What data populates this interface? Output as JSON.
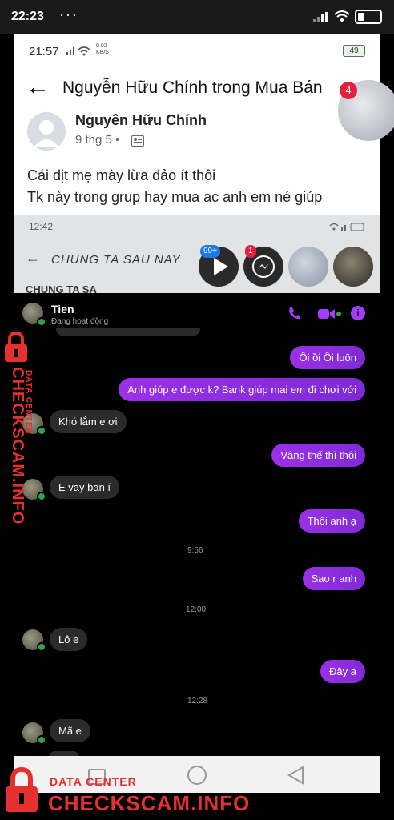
{
  "outer_status": {
    "time": "22:23",
    "dots": "···"
  },
  "inner_status": {
    "time": "21:57",
    "speed": "0.02 KB/S",
    "battery": "49"
  },
  "fb_header": {
    "title": "Nguyễn Hữu Chính trong Mua Bán"
  },
  "chat_head_badge": "4",
  "post": {
    "author": "Nguyên Hữu Chính",
    "date": "9 thg 5 •",
    "line1": "Cái địt mẹ mày lừa đảo ít thôi",
    "line2": "Tk này trong grup hay mua ac anh em né giúp"
  },
  "nested": {
    "status_time": "12:42",
    "title": "CHUNG TA SAU NAY",
    "subtitle": "CHUNG TA SA",
    "badge_a": "99+",
    "badge_b": "1"
  },
  "messenger": {
    "contact_name": "Tien",
    "contact_status": "Đang hoạt động",
    "accent": "#8a2be2",
    "messages": [
      {
        "side": "out",
        "text": "Ối ồi Ồi luôn"
      },
      {
        "side": "out",
        "text": "Anh giúp e được k? Bank giúp mai em đi chơi với"
      },
      {
        "side": "in",
        "text": "Khó lắm e ơi"
      },
      {
        "side": "out",
        "text": "Vâng thế thì thôi"
      },
      {
        "side": "in",
        "text": "E vay bạn í"
      },
      {
        "side": "out",
        "text": "Thôi anh ạ"
      },
      {
        "side": "time",
        "text": "9:56"
      },
      {
        "side": "out",
        "text": "Sao r anh"
      },
      {
        "side": "time",
        "text": "12:00"
      },
      {
        "side": "in",
        "text": "Lô e"
      },
      {
        "side": "out",
        "text": "Đây a"
      },
      {
        "side": "time",
        "text": "12:28"
      },
      {
        "side": "in",
        "text": "Mã e"
      }
    ]
  },
  "watermark": {
    "top_small": "DATA CENTER",
    "top_big": "CHECKSCAM.INFO",
    "bottom_small": "DATA CENTER",
    "bottom_big": "CHECKSCAM.INFO"
  }
}
